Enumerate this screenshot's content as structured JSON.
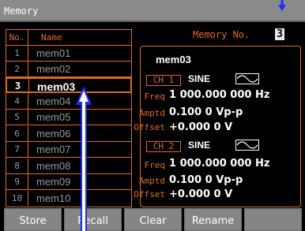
{
  "window": {
    "title": "Memory"
  },
  "memory_table": {
    "header_no": "No.",
    "header_name": "Name",
    "rows": [
      {
        "no": "1",
        "name": "mem01"
      },
      {
        "no": "2",
        "name": "mem02"
      },
      {
        "no": "3",
        "name": "mem03"
      },
      {
        "no": "4",
        "name": "mem04"
      },
      {
        "no": "5",
        "name": "mem05"
      },
      {
        "no": "6",
        "name": "mem06"
      },
      {
        "no": "7",
        "name": "mem07"
      },
      {
        "no": "8",
        "name": "mem08"
      },
      {
        "no": "9",
        "name": "mem09"
      },
      {
        "no": "10",
        "name": "mem10"
      }
    ],
    "selected_no": "3"
  },
  "memory_no": {
    "label": "Memory No.",
    "value": "3"
  },
  "detail": {
    "name": "mem03",
    "channels": [
      {
        "channel": "CH 1",
        "waveform": "SINE",
        "freq_label": "Freq",
        "freq_value": "1 000.000 000 Hz",
        "amptd_label": "Amptd",
        "amptd_value": "0.100 0 Vp-p",
        "offset_label": "Offset",
        "offset_value": "+0.000 0 V"
      },
      {
        "channel": "CH 2",
        "waveform": "SINE",
        "freq_label": "Freq",
        "freq_value": "1 000.000 000 Hz",
        "amptd_label": "Amptd",
        "amptd_value": "0.100 0 Vp-p",
        "offset_label": "Offset",
        "offset_value": "+0.000 0 V"
      }
    ]
  },
  "softkeys": {
    "store": "Store",
    "recall": "Recall",
    "clear": "Clear",
    "rename": "Rename",
    "blank": ""
  },
  "icons": {
    "waveform": "sine-wave-icon",
    "pointer": "pointer-arrow-icon"
  },
  "colors": {
    "accent": "#e06a1b",
    "background": "#000000",
    "title_bar": "#8a8a8a",
    "softkey": "#858585",
    "pointer": "#1b2ef0"
  }
}
